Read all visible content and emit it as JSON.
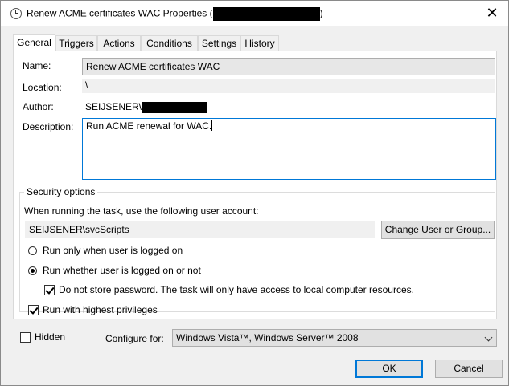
{
  "window": {
    "title_prefix": "Renew ACME certificates WAC Properties (",
    "title_suffix": ")",
    "close_glyph": "✕"
  },
  "tabs": [
    {
      "label": "General",
      "active": true
    },
    {
      "label": "Triggers"
    },
    {
      "label": "Actions"
    },
    {
      "label": "Conditions"
    },
    {
      "label": "Settings"
    },
    {
      "label": "History"
    }
  ],
  "general": {
    "name_label": "Name:",
    "name_value": "Renew ACME certificates WAC",
    "location_label": "Location:",
    "location_value": "\\",
    "author_label": "Author:",
    "author_value": "SEIJSENER\\",
    "description_label": "Description:",
    "description_value": "Run ACME renewal for WAC."
  },
  "security": {
    "title": "Security options",
    "account_prompt": "When running the task, use the following user account:",
    "account_value": "SEIJSENER\\svcScripts",
    "change_button": "Change User or Group...",
    "radio_logged_on": "Run only when user is logged on",
    "radio_whether": "Run whether user is logged on or not",
    "no_store_password": "Do not store password.  The task will only have access to local computer resources.",
    "highest_privileges": "Run with highest privileges"
  },
  "footer": {
    "hidden_label": "Hidden",
    "configure_label": "Configure for:",
    "configure_value": "Windows Vista™, Windows Server™ 2008",
    "ok_button": "OK",
    "cancel_button": "Cancel"
  },
  "state": {
    "radio_selected": "whether",
    "no_store_password_checked": true,
    "highest_privileges_checked": true,
    "hidden_checked": false
  }
}
